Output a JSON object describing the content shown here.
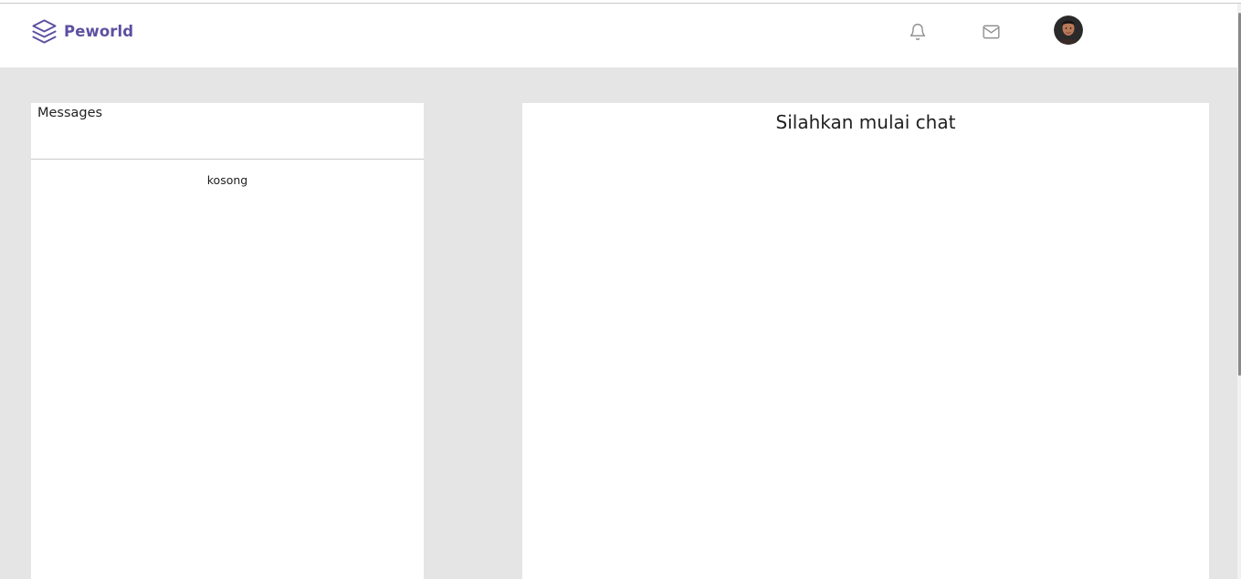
{
  "header": {
    "brand_name": "Peworld",
    "brand_color": "#5e50a1",
    "brand_icon": "layers-icon",
    "notification_icon": "bell-icon",
    "mail_icon": "mail-icon",
    "avatar_icon": "user-avatar"
  },
  "sidebar": {
    "title": "Messages",
    "empty_text": "kosong"
  },
  "chat": {
    "placeholder_title": "Silahkan mulai chat"
  }
}
